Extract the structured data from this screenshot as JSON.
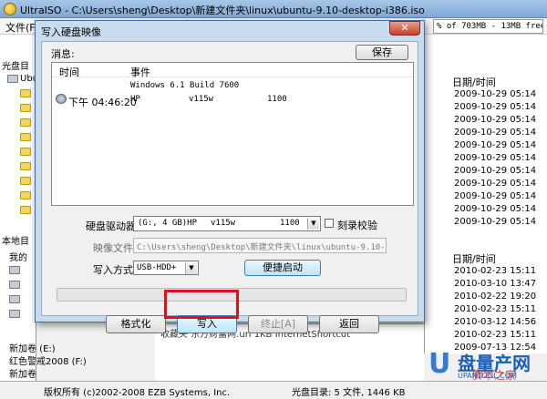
{
  "app": {
    "title": "UltraISO - C:\\Users\\sheng\\Desktop\\新建文件夹\\linux\\ubuntu-9.10-desktop-i386.iso",
    "menu_file": "文件(F)",
    "size_info": "% of 703MB - 13MB free"
  },
  "left": {
    "disc_dir_label": "光盘目",
    "tree_root": "Ubu",
    "local_dir_label": "本地目",
    "local_root": "我的",
    "drive_f": "新加卷 (F:)",
    "drive_e": "新加卷 (E:)",
    "drive_red": "红色警戒2008 (F:)",
    "drive_new": "新加卷"
  },
  "right": {
    "header_top": "日期/时间",
    "dates_top": [
      "2009-10-29 05:14",
      "2009-10-29 05:14",
      "2009-10-29 05:14",
      "2009-10-29 05:14",
      "2009-10-29 05:14",
      "2009-10-29 05:14",
      "2009-10-29 05:14",
      "2009-10-29 05:14",
      "2009-10-29 05:14",
      "2009-10-29 05:14",
      "2009-10-29 05:14"
    ],
    "header_bottom": "日期/时间",
    "dates_bottom": [
      "2010-02-23 15:11",
      "2010-03-10 13:47",
      "2010-02-22 19:20",
      "2010-02-23 15:11",
      "2010-03-12 14:56",
      "2010-02-23 15:11",
      "2009-07-13 12:54",
      "2010-02-23 21:21"
    ]
  },
  "bottom_list": {
    "row": "收藏夹  东方财富网.url   1KB   InternetShortcut"
  },
  "status": {
    "copyright": "版权所有 (c)2002-2008 EZB Systems, Inc.",
    "disc_dir": "光盘目录: 5 文件, 1446 KB"
  },
  "watermark": {
    "u": "U",
    "name": "盘量产网",
    "sub": "脚本之家",
    "url": "UPANTOOL.COM"
  },
  "dialog": {
    "title": "写入硬盘映像",
    "close": "✕",
    "messages_label": "消息:",
    "save": "保存",
    "col_time": "时间",
    "col_event": "事件",
    "event1": "Windows 6.1 Build 7600",
    "row2_time": "下午 04:46:20",
    "row2_event": "HP",
    "row2_model": "v115w",
    "row2_val": "1100",
    "drive_label": "硬盘驱动器:",
    "drive_sel_1": "(G:, 4 GB)HP",
    "drive_sel_2": "v115w",
    "drive_sel_3": "1100",
    "verify_label": "刻录校验",
    "image_label": "映像文件:",
    "image_path": "C:\\Users\\sheng\\Desktop\\新建文件夹\\linux\\ubuntu-9.10-desktop",
    "method_label": "写入方式:",
    "method_value": "USB-HDD+",
    "boot_button": "便捷启动",
    "format_button": "格式化",
    "write_button": "写入",
    "stop_button": "终止[A]",
    "back_button": "返回",
    "progress": 0
  }
}
